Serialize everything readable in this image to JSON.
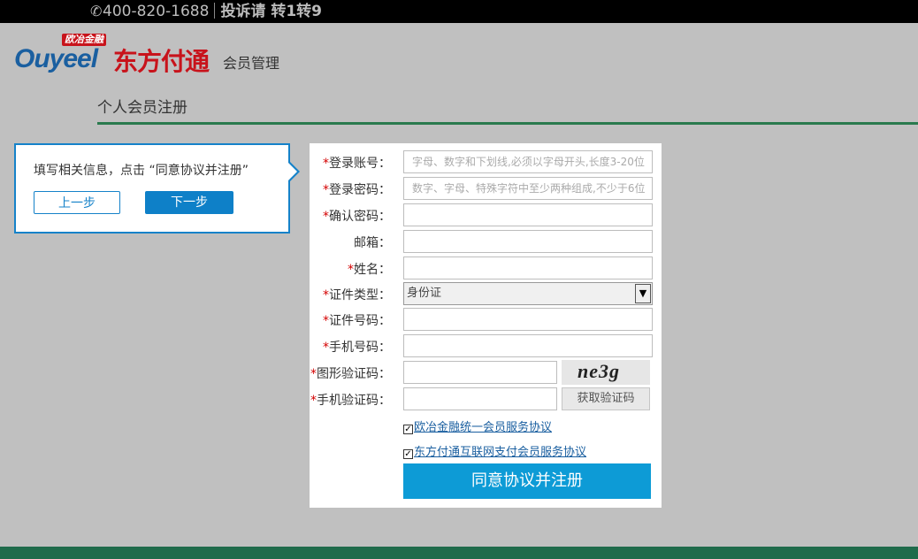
{
  "topbar": {
    "phone": "400-820-1688",
    "complaint": "投诉请 转1转9"
  },
  "header": {
    "badge": "欧冶金融",
    "brand_en": "Ouyeel",
    "brand_cn": "东方付通",
    "subtitle": "会员管理"
  },
  "page": {
    "title": "个人会员注册"
  },
  "tip": {
    "text": "填写相关信息，点击 “同意协议并注册”",
    "prev_label": "上一步",
    "next_label": "下一步"
  },
  "form": {
    "fields": [
      {
        "label": "登录账号：",
        "required": true,
        "placeholder": "字母、数字和下划线,必须以字母开头,长度3-20位"
      },
      {
        "label": "登录密码：",
        "required": true,
        "placeholder": "数字、字母、特殊字符中至少两种组成,不少于6位"
      },
      {
        "label": "确认密码：",
        "required": true,
        "placeholder": ""
      },
      {
        "label": "邮箱：",
        "required": false,
        "placeholder": ""
      },
      {
        "label": "姓名：",
        "required": true,
        "placeholder": ""
      },
      {
        "label": "证件类型：",
        "required": true,
        "value": "身份证"
      },
      {
        "label": "证件号码：",
        "required": true,
        "placeholder": ""
      },
      {
        "label": "手机号码：",
        "required": true,
        "placeholder": ""
      },
      {
        "label": "图形验证码：",
        "required": true,
        "captcha": "ne3g"
      },
      {
        "label": "手机验证码：",
        "required": true,
        "button": "获取验证码"
      }
    ],
    "required_mark": "*",
    "agreements": [
      {
        "checked": true,
        "label": "欧冶金融统一会员服务协议"
      },
      {
        "checked": true,
        "label": "东方付通互联网支付会员服务协议"
      }
    ],
    "submit_label": "同意协议并注册"
  },
  "colors": {
    "accent_blue": "#0e80c8",
    "submit_blue": "#0d9bd6",
    "brand_red": "#c8131b",
    "brand_blue": "#1a5fa0",
    "divider_green": "#2a7a4e"
  },
  "icons": {
    "phone": "phone-icon",
    "dropdown": "chevron-down-icon",
    "checkbox": "checkmark-icon"
  }
}
